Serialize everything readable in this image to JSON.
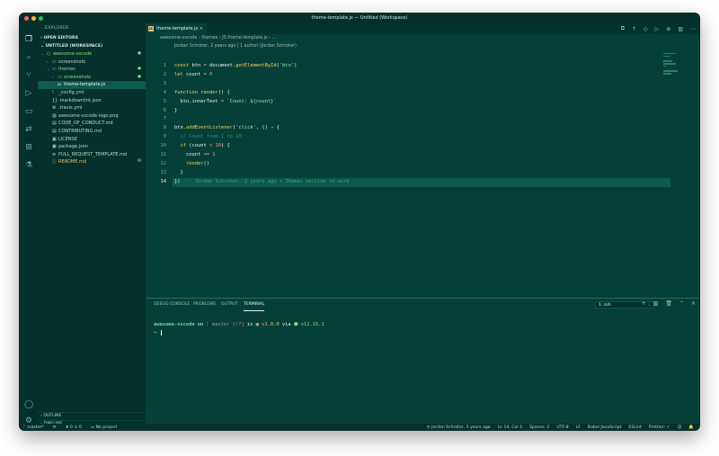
{
  "window": {
    "title": "theme-template.js — Untitled (Workspace)"
  },
  "colors": {
    "background": "#063f38",
    "sidebar": "#05302b",
    "keyword": "#f3d060",
    "string": "#9fe2b0",
    "comment": "#3f8e7f",
    "number": "#ff8c7a",
    "modified": "#e5c07b"
  },
  "activity_icons": [
    "files-icon",
    "search-icon",
    "source-control-icon",
    "run-debug-icon",
    "folder-icon",
    "remote-icon",
    "extensions-icon",
    "testing-icon",
    "account-icon",
    "settings-gear-icon"
  ],
  "sidebar": {
    "header": "EXPLORER",
    "open_editors": "OPEN EDITORS",
    "workspace": "UNTITLED (WORKSPACE)",
    "tree": [
      {
        "label": "awesome-vscode",
        "chevron": "⌄",
        "icon": "○",
        "status": "●",
        "level": 0,
        "color": "#7fe07f"
      },
      {
        "label": "screenshots",
        "chevron": "›",
        "icon": "▭",
        "status": "",
        "level": 1,
        "color": "#bcd9d3"
      },
      {
        "label": "themes",
        "chevron": "⌄",
        "icon": "▭",
        "status": "●",
        "level": 1,
        "color": "#7fe07f"
      },
      {
        "label": "screenshots",
        "chevron": "›",
        "icon": "▭",
        "status": "●",
        "level": 2,
        "color": "#7fe07f"
      },
      {
        "label": "theme-template.js",
        "chevron": "",
        "icon": "JS",
        "status": "",
        "level": 2,
        "color": "#e6f5f2",
        "selected": true
      },
      {
        "label": "_config.yml",
        "chevron": "",
        "icon": "!",
        "status": "",
        "level": 1,
        "color": "#bcd9d3"
      },
      {
        "label": ".markdownlint.json",
        "chevron": "",
        "icon": "{}",
        "status": "",
        "level": 1,
        "color": "#bcd9d3"
      },
      {
        "label": ".travis.yml",
        "chevron": "",
        "icon": "⚙",
        "status": "",
        "level": 1,
        "color": "#bcd9d3"
      },
      {
        "label": "awesome-vscode-logo.png",
        "chevron": "",
        "icon": "▨",
        "status": "",
        "level": 1,
        "color": "#bcd9d3"
      },
      {
        "label": "CODE_OF_CONDUCT.md",
        "chevron": "",
        "icon": "▤",
        "status": "",
        "level": 1,
        "color": "#bcd9d3"
      },
      {
        "label": "CONTRIBUTING.md",
        "chevron": "",
        "icon": "▤",
        "status": "",
        "level": 1,
        "color": "#bcd9d3"
      },
      {
        "label": "LICENSE",
        "chevron": "",
        "icon": "▣",
        "status": "",
        "level": 1,
        "color": "#bcd9d3"
      },
      {
        "label": "package.json",
        "chevron": "",
        "icon": "▣",
        "status": "",
        "level": 1,
        "color": "#bcd9d3"
      },
      {
        "label": "PULL_REQUEST_TEMPLATE.md",
        "chevron": "",
        "icon": "≡",
        "status": "",
        "level": 1,
        "color": "#bcd9d3"
      },
      {
        "label": "README.md",
        "chevron": "",
        "icon": "ⓘ",
        "status": "M",
        "level": 1,
        "color": "#e5c07b"
      }
    ],
    "footer": [
      "OUTLINE",
      "TIMELINE",
      "NPM SCRIPTS"
    ]
  },
  "editor": {
    "tab": {
      "label": "theme-template.js",
      "badge": "JS",
      "close": "×"
    },
    "breadcrumb": "awesome-vscode  ›  themes  ›  JS  theme-template.js  ›  …",
    "blame_header": "Jordan Schroter, 2 years ago | 1 author (Jordan Schroter)",
    "line_numbers": [
      "1",
      "2",
      "3",
      "4",
      "5",
      "6",
      "7",
      "8",
      "9",
      "10",
      "11",
      "12",
      "13",
      "14"
    ],
    "inline_blame": "Jordan Schroter, 2 years ago • Themes section re-work"
  },
  "panel": {
    "tabs": [
      "DEBUG CONSOLE",
      "PROBLEMS",
      "OUTPUT",
      "TERMINAL"
    ],
    "terminal_select": "1: zsh",
    "prompt": {
      "dir": "awesome-vscode",
      "on": " on ",
      "branch": " master",
      "status": " [!?]",
      "is": " is ",
      "version": " v1.0.0",
      "via": " via ",
      "node": " v12.16.1",
      "arrow": "→"
    }
  },
  "status": {
    "branch": "master*",
    "sync": "⟳",
    "problems": "⊗ 0 ⚠ 0",
    "project": "No project",
    "blame": "Jordan Schroter, 2 years ago",
    "position": "Ln 14, Col 3",
    "spaces": "Spaces: 2",
    "encoding": "UTF-8",
    "eol": "LF",
    "language": "Babel JavaScript",
    "linter": "ESLint",
    "prettier": "Prettier: ✓"
  }
}
